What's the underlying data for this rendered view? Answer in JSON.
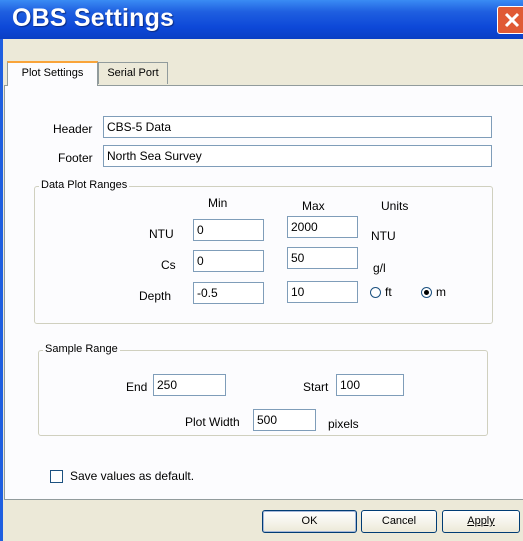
{
  "window": {
    "title": "OBS Settings"
  },
  "tabs": [
    {
      "label": "Plot Settings",
      "active": true
    },
    {
      "label": "Serial Port",
      "active": false
    }
  ],
  "header": {
    "label": "Header",
    "value": "CBS-5 Data"
  },
  "footer": {
    "label": "Footer",
    "value": "North Sea Survey"
  },
  "plot_ranges": {
    "title": "Data Plot Ranges",
    "col_min": "Min",
    "col_max": "Max",
    "col_units": "Units",
    "ntu": {
      "label": "NTU",
      "min": "0",
      "max": "2000",
      "unit": "NTU"
    },
    "cs": {
      "label": "Cs",
      "min": "0",
      "max": "50",
      "unit": "g/l"
    },
    "depth": {
      "label": "Depth",
      "min": "-0.5",
      "max": "10",
      "unit_ft": "ft",
      "unit_m": "m",
      "selected_unit": "m"
    }
  },
  "sample_range": {
    "title": "Sample Range",
    "end_label": "End",
    "end_value": "250",
    "start_label": "Start",
    "start_value": "100",
    "width_label": "Plot Width",
    "width_value": "500",
    "width_unit": "pixels"
  },
  "save_default": {
    "label": "Save values as default.",
    "checked": false
  },
  "buttons": {
    "ok": "OK",
    "cancel": "Cancel",
    "apply": "Apply"
  }
}
